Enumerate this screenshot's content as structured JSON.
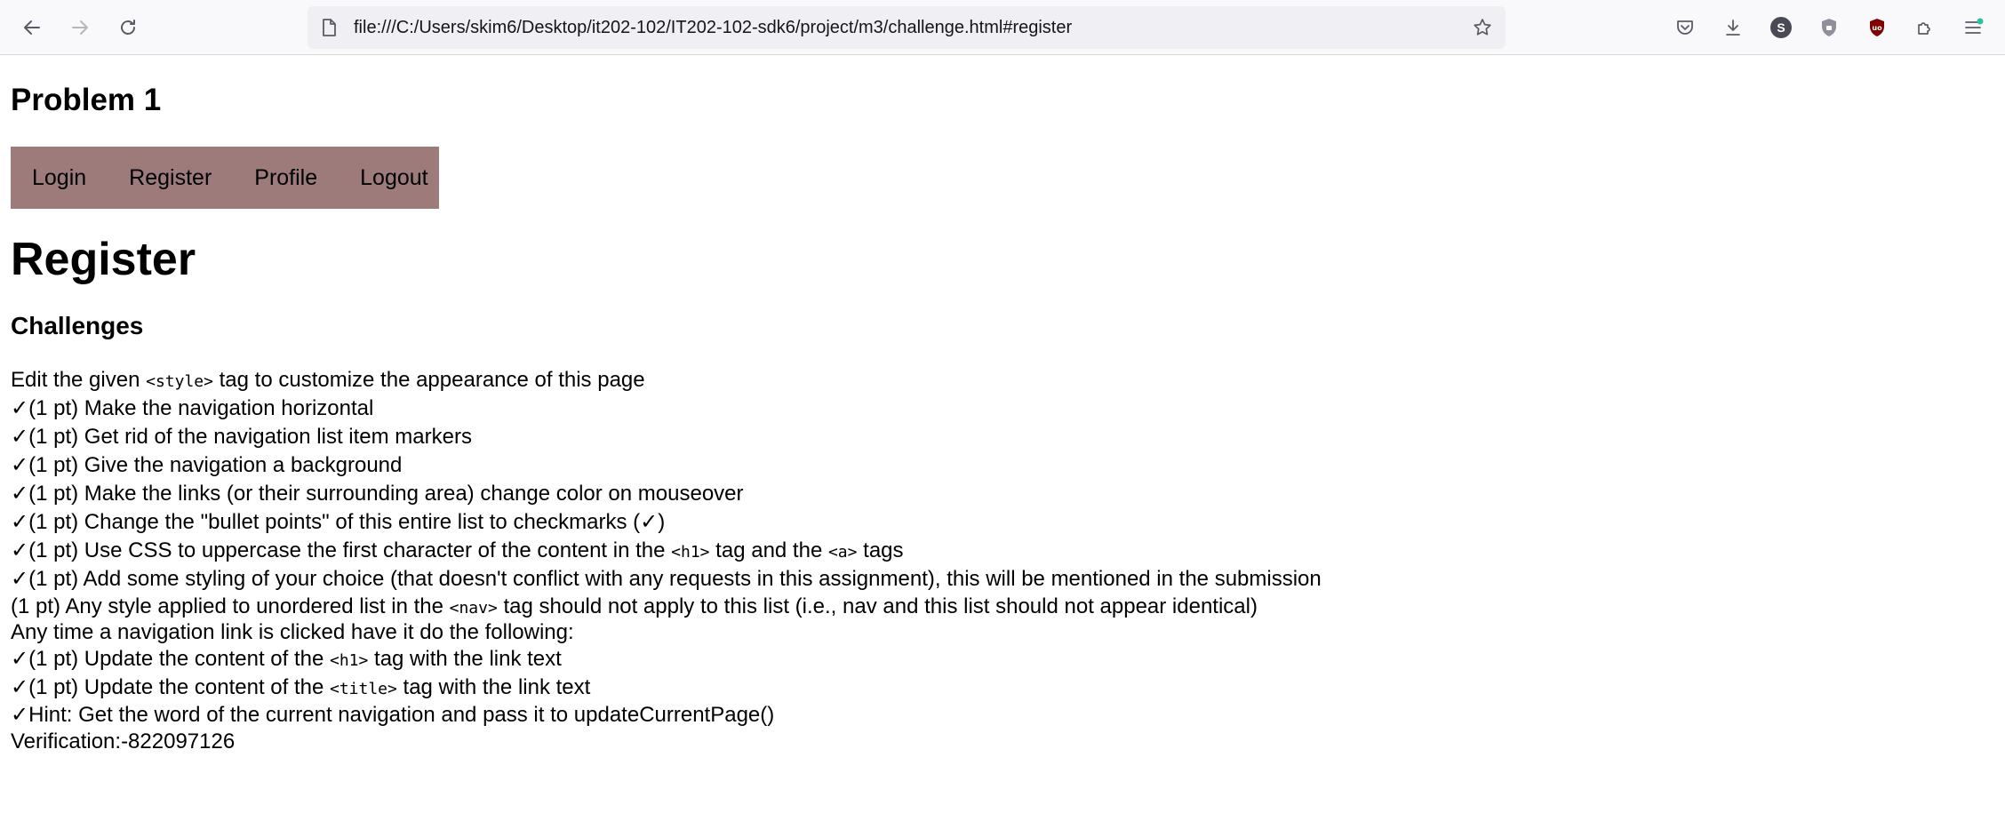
{
  "browser": {
    "url": "file:///C:/Users/skim6/Desktop/it202-102/IT202-102-sdk6/project/m3/challenge.html#register",
    "profile_letter": "S"
  },
  "page": {
    "title": "Problem 1",
    "nav": [
      "Login",
      "Register",
      "Profile",
      "Logout"
    ],
    "heading": "Register",
    "subheading": "Challenges",
    "intro_pre": "Edit the given ",
    "intro_code": "<style>",
    "intro_post": " tag to customize the appearance of this page",
    "items": [
      "✓(1 pt) Make the navigation horizontal",
      "✓(1 pt) Get rid of the navigation list item markers",
      "✓(1 pt) Give the navigation a background",
      "✓(1 pt) Make the links (or their surrounding area) change color on mouseover",
      "✓(1 pt) Change the \"bullet points\" of this entire list to checkmarks (✓)"
    ],
    "item6_pre": "✓(1 pt) Use CSS to uppercase the first character of the content in the ",
    "item6_code1": "<h1>",
    "item6_mid": " tag and the ",
    "item6_code2": "<a>",
    "item6_post": " tags",
    "item7": "✓(1 pt) Add some styling of your choice (that doesn't conflict with any requests in this assignment), this will be mentioned in the submission",
    "item8_pre": "(1 pt) Any style applied to unordered list in the ",
    "item8_code": "<nav>",
    "item8_post": " tag should not apply to this list (i.e., nav and this list should not appear identical)",
    "nav_intro": "Any time a navigation link is clicked have it do the following:",
    "item9_pre": "✓(1 pt) Update the content of the ",
    "item9_code": "<h1>",
    "item9_post": " tag with the link text",
    "item10_pre": "✓(1 pt) Update the content of the ",
    "item10_code": "<title>",
    "item10_post": " tag with the link text",
    "hint": "✓Hint: Get the word of the current navigation and pass it to updateCurrentPage()",
    "verification": "Verification:-822097126"
  }
}
